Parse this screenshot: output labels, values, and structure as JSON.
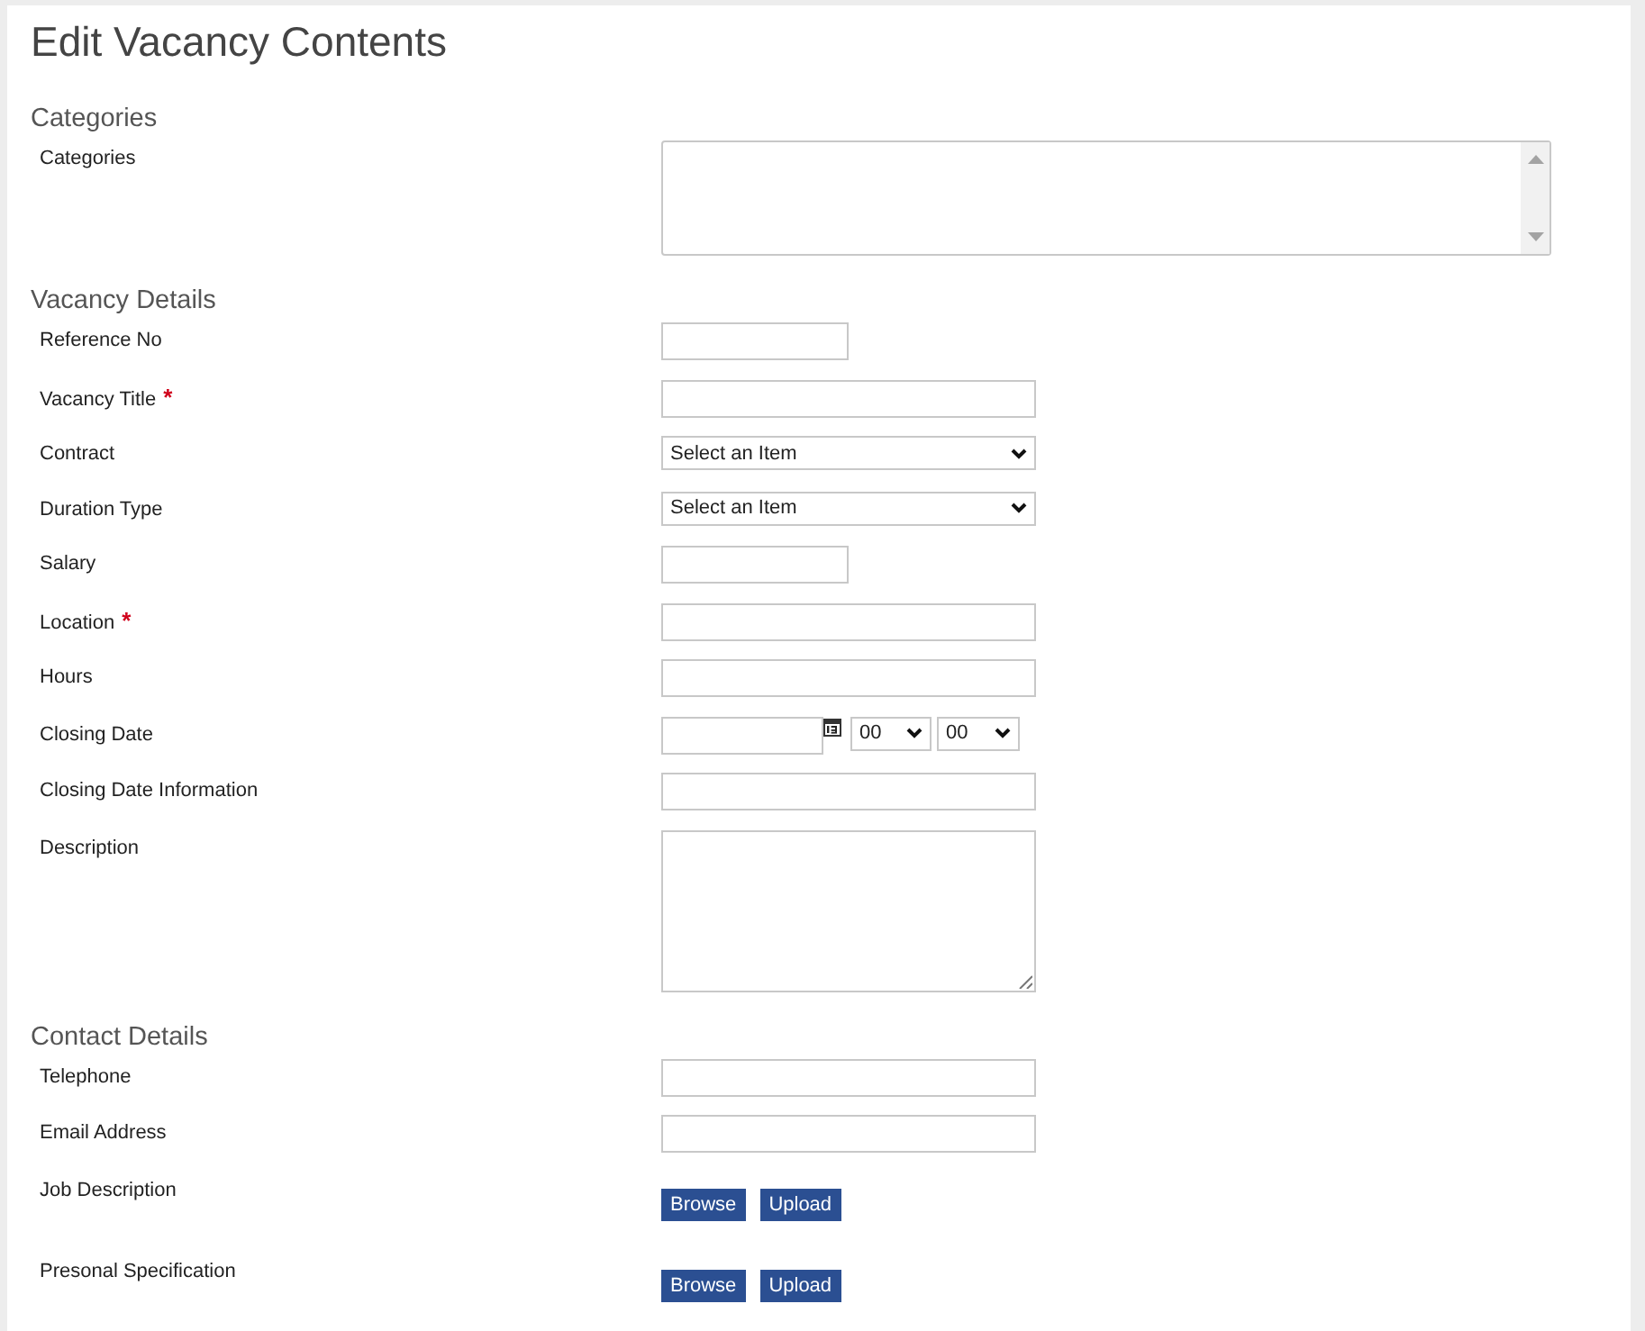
{
  "page": {
    "title": "Edit Vacancy Contents"
  },
  "sections": [
    {
      "heading": "Categories",
      "fields": [
        {
          "label": "Categories",
          "kind": "listbox"
        }
      ]
    },
    {
      "heading": "Vacancy Details",
      "fields": [
        {
          "label": "Reference No",
          "kind": "short_text"
        },
        {
          "label": "Vacancy Title",
          "kind": "text",
          "required_mark": "*"
        },
        {
          "label": "Contract",
          "kind": "select",
          "value": "Select an Item"
        },
        {
          "label": "Duration Type",
          "kind": "select",
          "value": "Select an Item"
        },
        {
          "label": "Salary",
          "kind": "short_text"
        },
        {
          "label": "Location",
          "kind": "text",
          "required_mark": "*"
        },
        {
          "label": "Hours",
          "kind": "text"
        },
        {
          "label": "Closing Date",
          "kind": "datetime",
          "hour": "00",
          "minute": "00"
        },
        {
          "label": "Closing Date Information",
          "kind": "text"
        },
        {
          "label": "Description",
          "kind": "textarea"
        }
      ]
    },
    {
      "heading": "Contact Details",
      "fields": [
        {
          "label": "Telephone",
          "kind": "text"
        },
        {
          "label": "Email Address",
          "kind": "text"
        },
        {
          "label": "Job Description",
          "kind": "file",
          "buttons": [
            "Browse",
            "Upload"
          ]
        },
        {
          "label": "Presonal Specification",
          "kind": "file",
          "buttons": [
            "Browse",
            "Upload"
          ]
        }
      ]
    }
  ]
}
